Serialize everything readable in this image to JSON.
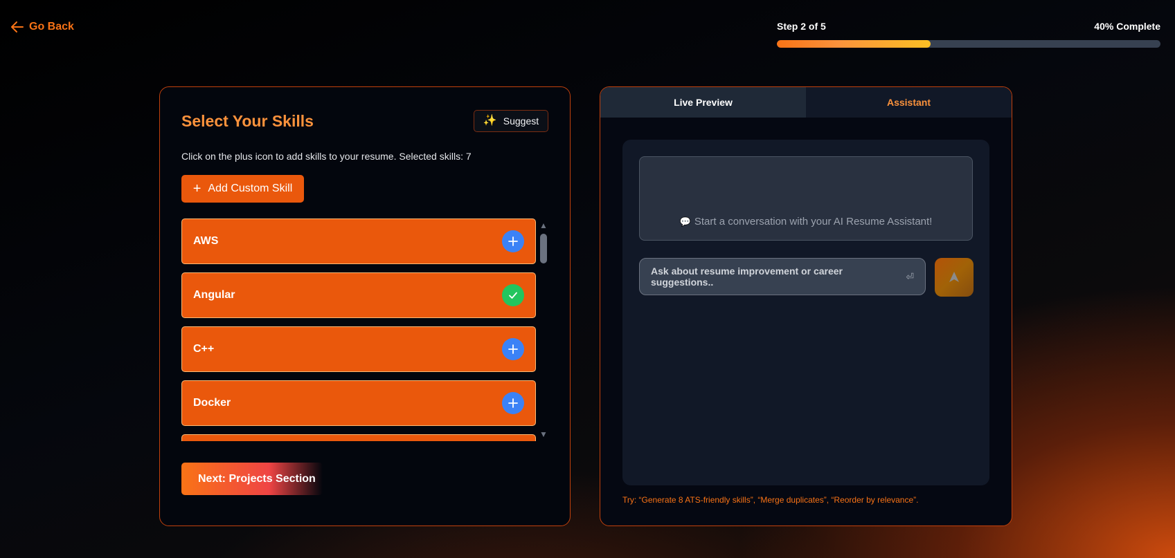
{
  "header": {
    "go_back_label": "Go Back",
    "step_label": "Step 2 of 5",
    "percent_label": "40% Complete",
    "progress_percent": 40,
    "accent_color": "#f97316"
  },
  "skills_section": {
    "title": "Select Your Skills",
    "suggest_label": "Suggest",
    "description": "Click on the plus icon to add skills to your resume. Selected skills: 7",
    "add_custom_label": "Add Custom Skill",
    "items": [
      {
        "name": "AWS",
        "selected": false,
        "action_icon": "plus-icon"
      },
      {
        "name": "Angular",
        "selected": true,
        "action_icon": "check-icon"
      },
      {
        "name": "C++",
        "selected": false,
        "action_icon": "plus-icon"
      },
      {
        "name": "Docker",
        "selected": false,
        "action_icon": "plus-icon"
      }
    ],
    "next_label": "Next: Projects Section"
  },
  "right_panel": {
    "tabs": [
      {
        "label": "Live Preview",
        "active": true
      },
      {
        "label": "Assistant",
        "active": false
      }
    ],
    "chat_empty_message": "Start a conversation with your AI Resume Assistant!",
    "input_placeholder": "Ask about resume improvement or career suggestions..",
    "hint": "Try: “Generate 8 ATS-friendly skills”, “Merge duplicates”, “Reorder by relevance”."
  }
}
